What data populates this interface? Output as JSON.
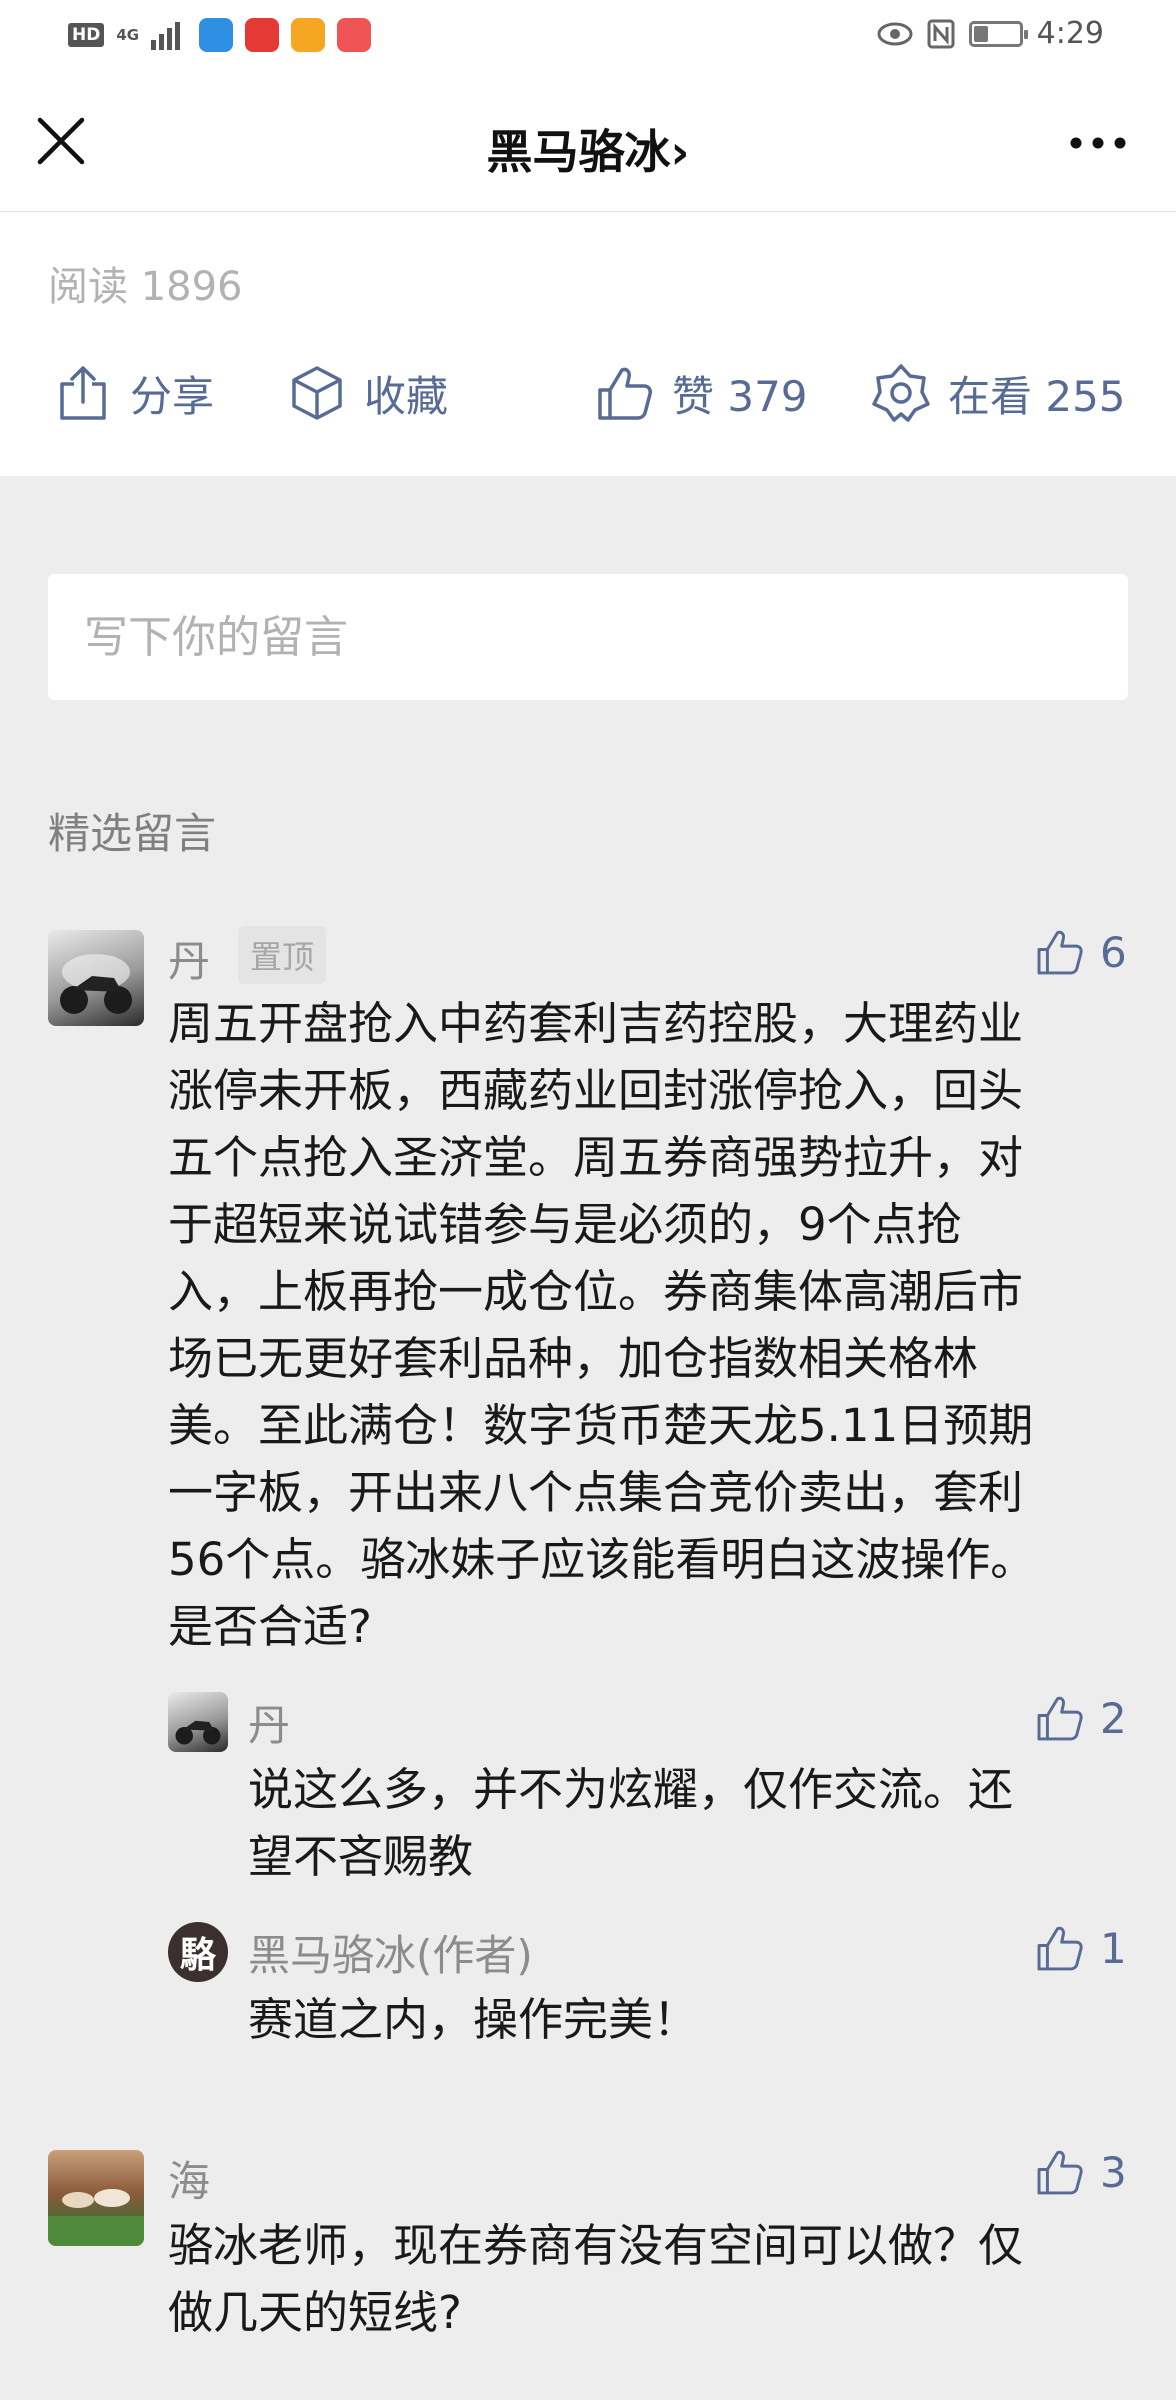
{
  "status_bar": {
    "hd": "HD",
    "network": "4G",
    "time": "4:29",
    "icons": [
      "hd-icon",
      "signal-icon",
      "wifi-icon",
      "huawei-app-icon",
      "weibo-icon",
      "book-icon",
      "eye-icon",
      "nfc-icon",
      "battery-icon"
    ],
    "colors": {
      "wifi": "#2f8fe3",
      "huawei": "#e53935",
      "weibo": "#f5a623",
      "book": "#f05454"
    }
  },
  "nav": {
    "title": "黑马骆冰",
    "chevron": "›"
  },
  "stats": {
    "read": "阅读 1896",
    "share": "分享",
    "favorite": "收藏",
    "like": "赞 379",
    "watching": "在看 255"
  },
  "input": {
    "placeholder": "写下你的留言"
  },
  "section": {
    "title": "精选留言"
  },
  "comments": [
    {
      "name": "丹",
      "pinned": "置顶",
      "likes": "6",
      "lines": [
        "周五开盘抢入中药套利吉药控股，大理药业",
        "涨停未开板，西藏药业回封涨停抢入，回头",
        "五个点抢入圣济堂。周五券商强势拉升，对",
        "于超短来说试错参与是必须的，9个点抢",
        "入，上板再抢一成仓位。券商集体高潮后市",
        "场已无更好套利品种，加仓指数相关格林",
        "美。至此满仓！数字货币楚天龙5.11日预期",
        "一字板，开出来八个点集合竞价卖出，套利",
        "56个点。骆冰妹子应该能看明白这波操作。",
        "是否合适?"
      ],
      "replies": [
        {
          "name": "丹",
          "likes": "2",
          "lines": [
            "说这么多，并不为炫耀，仅作交流。还",
            "望不吝赐教"
          ]
        },
        {
          "name": "黑马骆冰(作者)",
          "avatar_char": "駱",
          "likes": "1",
          "lines": [
            "赛道之内，操作完美！"
          ]
        }
      ]
    },
    {
      "name": "海",
      "likes": "3",
      "lines": [
        "骆冰老师，现在券商有没有空间可以做？仅",
        "做几天的短线?"
      ]
    }
  ],
  "colors": {
    "link_blue": "#576b95",
    "gray_text": "#8c8c8c",
    "background": "#ededed"
  }
}
